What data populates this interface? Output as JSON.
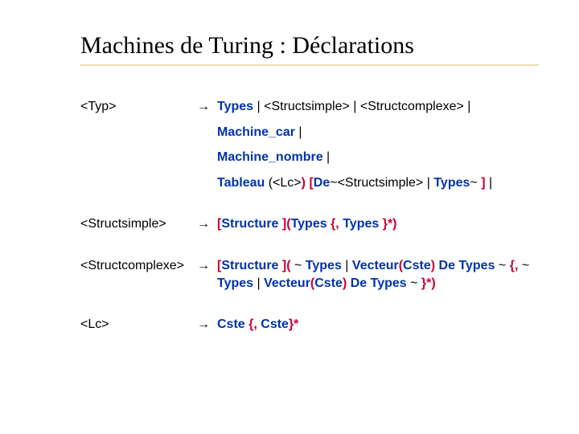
{
  "title": "Machines de Turing : Déclarations",
  "arrow": "→",
  "rules": {
    "typ": {
      "lhs": "<Typ>",
      "rhs": {
        "types": "Types",
        "structsimple": "<Structsimple>",
        "structcomplexe": "<Structcomplexe>",
        "pipe": " | "
      }
    },
    "machine_car": "Machine_car",
    "machine_nombre": "Machine_nombre",
    "tableau": {
      "tableau": "Tableau",
      "lc_open": " (",
      "lc": "<Lc>",
      "lc_close": ")",
      "sp": " ",
      "lbrack": "[",
      "de": "De",
      "tilde1": "~",
      "structsimple": "<Structsimple>",
      "pipe": " | ",
      "types": "Types",
      "tilde2": "~ ",
      "rbrack": "]",
      "trailpipe": " |"
    },
    "structsimple": {
      "lhs": "<Structsimple>",
      "rhs": {
        "lbrack": "[",
        "structure": "Structure ",
        "rbrack_paren": "](",
        "types1": "Types",
        "sep_open": " {",
        "comma": ",",
        "sp": " ",
        "types2": "Types",
        "sep_close": " }*",
        "close": ")"
      }
    },
    "structcomplexe": {
      "lhs": "<Structcomplexe>",
      "rhs": {
        "lbrack": "[",
        "structure": "Structure ",
        "rbrack_paren": "](",
        "tilde_sp": " ~ ",
        "types1": "Types",
        "pipe": " | ",
        "vecteur1": "Vecteur",
        "paren_o1": "(",
        "cste1": "Cste",
        "paren_c1": ")",
        "sp1": " ",
        "de1": "De",
        "sp2": " ",
        "types2": "Types",
        "tilde2": " ~ ",
        "brace_o": "{",
        "comma": ",",
        "tilde3": " ~ ",
        "types3": "Types",
        "pipe2": " | ",
        "vecteur2": "Vecteur",
        "paren_o2": "(",
        "cste2": "Cste",
        "paren_c2": ")",
        "sp3": " ",
        "de2": "De",
        "sp4": " ",
        "types4": "Types",
        "tilde4": " ~  ",
        "brace_c": "}*",
        "close": ")"
      }
    },
    "lc": {
      "lhs": "<Lc>",
      "rhs": {
        "cste1": "Cste",
        "sep_open": " {",
        "comma": ",",
        "sp": " ",
        "cste2": "Cste",
        "sep_close": "}*"
      }
    }
  }
}
